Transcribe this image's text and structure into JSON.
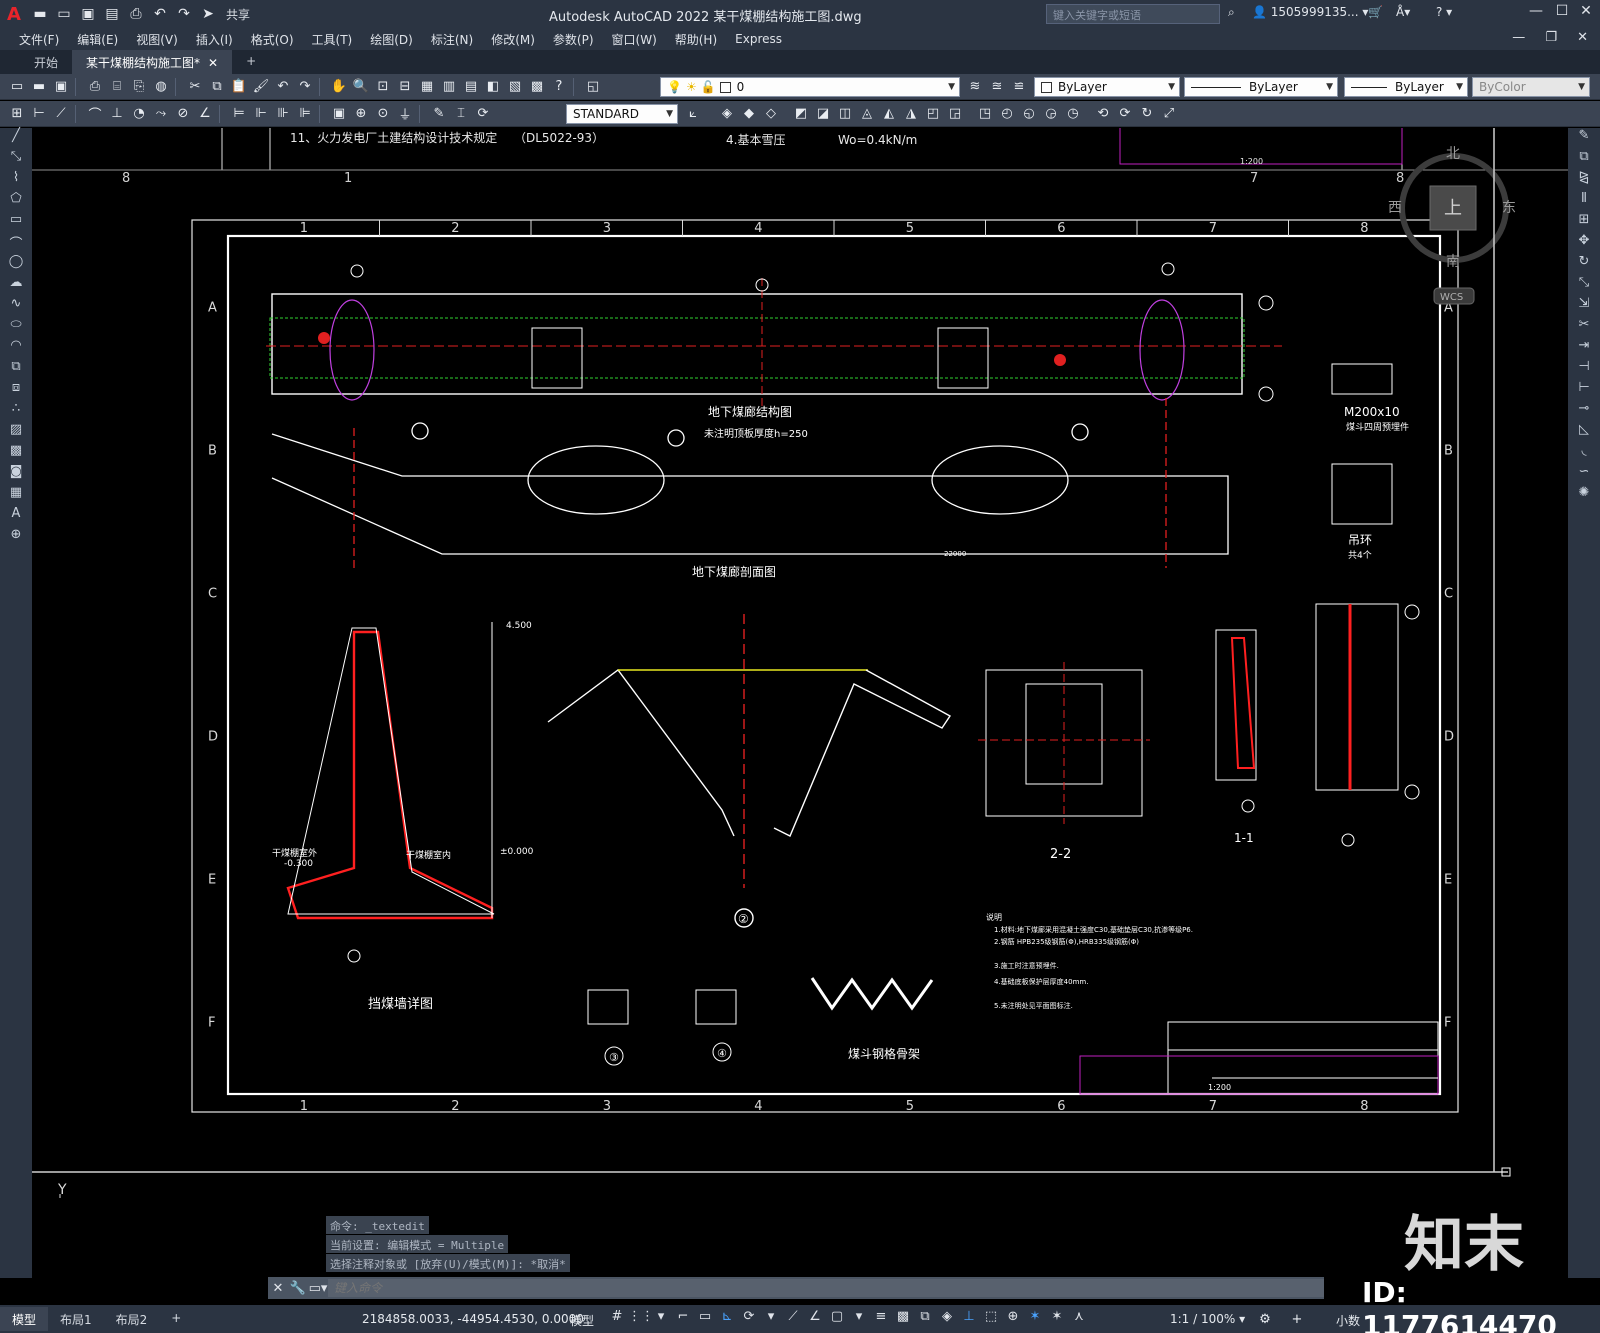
{
  "app": {
    "title": "Autodesk AutoCAD 2022    某干煤棚结构施工图.dwg",
    "share_label": "共享",
    "search_placeholder": "键入关键字或短语",
    "user": "1505999135...",
    "colors": {
      "titlebar": "#2b3442",
      "toolbar": "#3b4453",
      "canvas": "#000000",
      "accent_red": "#e8242b"
    }
  },
  "menu": [
    "文件(F)",
    "编辑(E)",
    "视图(V)",
    "插入(I)",
    "格式(O)",
    "工具(T)",
    "绘图(D)",
    "标注(N)",
    "修改(M)",
    "参数(P)",
    "窗口(W)",
    "帮助(H)",
    "Express"
  ],
  "tabs": {
    "start": "开始",
    "active": "某干煤棚结构施工图*"
  },
  "toolbar": {
    "layer_value": "0",
    "color_value": "ByLayer",
    "linetype_value": "ByLayer",
    "lineweight_value": "ByLayer",
    "plotstyle_value": "ByColor",
    "textstyle_value": "STANDARD"
  },
  "viewcube": {
    "north": "北",
    "south": "南",
    "east": "东",
    "west": "西",
    "top": "上",
    "wcs": "WCS"
  },
  "drawing": {
    "grid_cols": [
      "1",
      "2",
      "3",
      "4",
      "5",
      "6",
      "7",
      "8"
    ],
    "grid_rows": [
      "A",
      "B",
      "C",
      "D",
      "E",
      "F"
    ],
    "prev_sheet_text1": "11、火力发电厂土建结构设计技术规定",
    "prev_sheet_text2": "（DL5022-93）",
    "prev_sheet_text3": "4.基本雪压",
    "prev_sheet_text4": "Wo=0.4kN/m",
    "prev_sheet_scale": "1:200",
    "plan_title": "地下煤廊结构图",
    "plan_note": "未注明顶板厚度h=250",
    "section_title": "地下煤廊剖面图",
    "wall_title": "挡煤墙详图",
    "hopper_title": "煤斗钢格骨架",
    "m200_label": "M200x10",
    "m200_note": "煤斗四周预埋件",
    "ring_label": "吊环",
    "ring_note": "共4个",
    "sec22": "2-2",
    "sec11": "1-1",
    "detail2": "②",
    "detail3": "③",
    "detail4": "④",
    "dim_22000": "22000",
    "elev_4500": "4.500",
    "elev_0": "±0.000",
    "elev_m300": "-0.300",
    "notes_header": "说明",
    "note_1": "1.材料:地下煤廊采用混凝土强度C30,基础垫层C30,抗渗等级P6.",
    "note_2": "2.钢筋 HPB235级钢筋(Φ),HRB335级钢筋(Φ)",
    "note_3": "3.施工时注意预埋件.",
    "note_4": "4.基础底板保护层厚度40mm.",
    "note_5": "5.未注明处见平面图标注.",
    "tb_scale": "1:200",
    "wall_label_1": "干煤棚室外",
    "wall_label_2": "干煤棚室内"
  },
  "command": {
    "history": [
      "命令: _textedit",
      "当前设置: 编辑模式 = Multiple",
      "选择注释对象或 [放弃(U)/模式(M)]: *取消*"
    ],
    "placeholder": "键入命令"
  },
  "status": {
    "layouts": [
      "模型",
      "布局1",
      "布局2"
    ],
    "coords": "2184858.0033, -44954.4530, 0.0000",
    "mode": "模型",
    "scale": "1:1 / 100%",
    "units": "小数"
  },
  "watermark": {
    "brand": "知末",
    "id": "ID: 1177614470"
  }
}
